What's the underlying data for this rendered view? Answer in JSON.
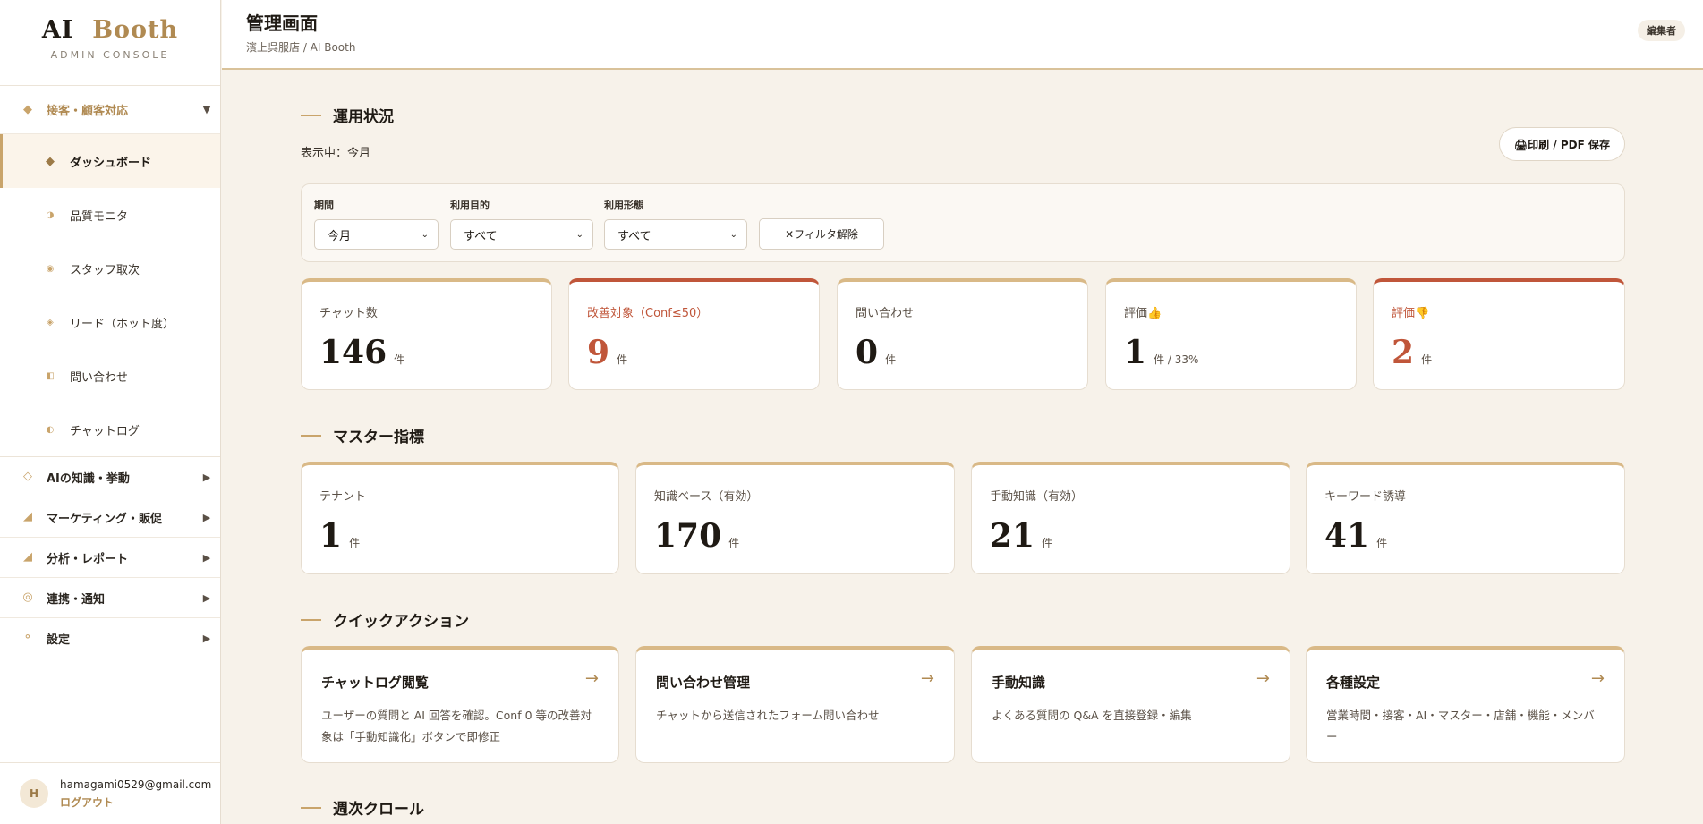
{
  "brand": {
    "title_main": "AI",
    "title_accent": "Booth",
    "subtitle": "ADMIN CONSOLE"
  },
  "sidebar": {
    "group_open": {
      "label": "接客・顧客対応",
      "arrow": "▼",
      "icon": "diamond-icon"
    },
    "items": [
      {
        "label": "ダッシュボード",
        "icon": "diamond-icon",
        "glyph": "◆"
      },
      {
        "label": "品質モニタ",
        "icon": "half-circle-icon",
        "glyph": "◑"
      },
      {
        "label": "スタッフ取次",
        "icon": "target-icon",
        "glyph": "◉"
      },
      {
        "label": "リード（ホット度）",
        "icon": "sparkle-icon",
        "glyph": "◈"
      },
      {
        "label": "問い合わせ",
        "icon": "half-square-icon",
        "glyph": "◧"
      },
      {
        "label": "チャットログ",
        "icon": "half-circle-icon",
        "glyph": "◐"
      }
    ],
    "groups": [
      {
        "label": "AIの知識・挙動",
        "arrow": "▶",
        "glyph": "◇"
      },
      {
        "label": "マーケティング・販促",
        "arrow": "▶",
        "glyph": "◢"
      },
      {
        "label": "分析・レポート",
        "arrow": "▶",
        "glyph": "◢"
      },
      {
        "label": "連携・通知",
        "arrow": "▶",
        "glyph": "◎"
      },
      {
        "label": "設定",
        "arrow": "▶",
        "glyph": "⚬"
      }
    ],
    "user": {
      "initial": "H",
      "email": "hamagami0529@gmail.com",
      "logout": "ログアウト"
    }
  },
  "header": {
    "title": "管理画面",
    "breadcrumb": "濱上呉服店 / AI Booth",
    "role": "編集者"
  },
  "ops": {
    "title": "運用状況",
    "status": "表示中：今月",
    "print": "🖨印刷 / PDF 保存",
    "filters": {
      "period_label": "期間",
      "period_value": "今月",
      "purpose_label": "利用目的",
      "purpose_value": "すべて",
      "mode_label": "利用形態",
      "mode_value": "すべて",
      "clear": "✕フィルタ解除",
      "chevron": "⌄"
    },
    "kpis": [
      {
        "label": "チャット数",
        "value": "146",
        "unit": "件"
      },
      {
        "label": "改善対象（Conf≤50）",
        "value": "9",
        "unit": "件"
      },
      {
        "label": "問い合わせ",
        "value": "0",
        "unit": "件"
      },
      {
        "label": "評価👍",
        "value": "1",
        "unit": "件 / 33%"
      },
      {
        "label": "評価👎",
        "value": "2",
        "unit": "件"
      }
    ]
  },
  "master": {
    "title": "マスター指標",
    "kpis": [
      {
        "label": "テナント",
        "value": "1",
        "unit": "件"
      },
      {
        "label": "知識ベース（有効）",
        "value": "170",
        "unit": "件"
      },
      {
        "label": "手動知識（有効）",
        "value": "21",
        "unit": "件"
      },
      {
        "label": "キーワード誘導",
        "value": "41",
        "unit": "件"
      }
    ]
  },
  "quick": {
    "title": "クイックアクション",
    "arrow": "→",
    "actions": [
      {
        "title": "チャットログ閲覧",
        "desc": "ユーザーの質問と AI 回答を確認。Conf 0 等の改善対象は「手動知識化」ボタンで即修正"
      },
      {
        "title": "問い合わせ管理",
        "desc": "チャットから送信されたフォーム問い合わせ"
      },
      {
        "title": "手動知識",
        "desc": "よくある質問の Q&A を直接登録・編集"
      },
      {
        "title": "各種設定",
        "desc": "営業時間・接客・AI・マスター・店舗・機能・メンバー"
      }
    ]
  },
  "weekly": {
    "title": "週次クロール"
  },
  "colors": {
    "accent": "#c9a46b",
    "alert": "#c0563a",
    "background": "#f7f2ea"
  }
}
